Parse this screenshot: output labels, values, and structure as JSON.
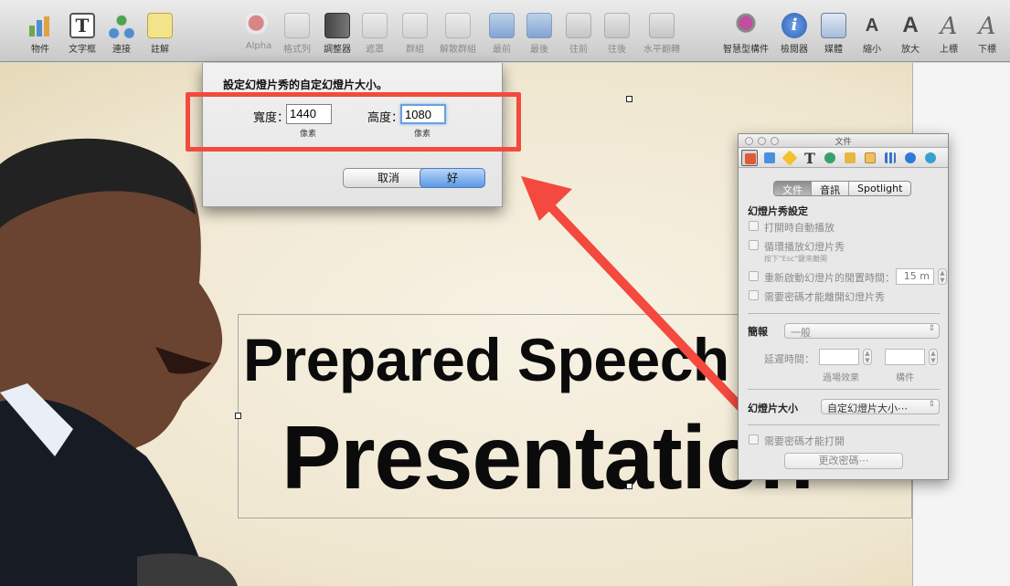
{
  "toolbar": {
    "items": [
      {
        "label": "物件",
        "icon": "chart-objects-icon"
      },
      {
        "label": "文字框",
        "icon": "text-box-icon"
      },
      {
        "label": "連接",
        "icon": "connection-icon"
      },
      {
        "label": "註解",
        "icon": "comment-icon"
      },
      {
        "label": "Alpha",
        "icon": "alpha-icon"
      },
      {
        "label": "格式列",
        "icon": "format-bar-icon"
      },
      {
        "label": "調整器",
        "icon": "adjust-image-icon"
      },
      {
        "label": "遮罩",
        "icon": "mask-icon"
      },
      {
        "label": "群組",
        "icon": "group-icon"
      },
      {
        "label": "解散群組",
        "icon": "ungroup-icon"
      },
      {
        "label": "最前",
        "icon": "front-icon"
      },
      {
        "label": "最後",
        "icon": "back-icon"
      },
      {
        "label": "往前",
        "icon": "forward-icon"
      },
      {
        "label": "往後",
        "icon": "backward-icon"
      },
      {
        "label": "水平翻轉",
        "icon": "flip-horizontal-icon"
      },
      {
        "label": "智慧型構件",
        "icon": "smart-build-icon"
      },
      {
        "label": "檢閱器",
        "icon": "inspector-icon"
      },
      {
        "label": "媒體",
        "icon": "media-icon"
      },
      {
        "label": "縮小",
        "icon": "smaller-font-icon"
      },
      {
        "label": "放大",
        "icon": "bigger-font-icon"
      },
      {
        "label": "上標",
        "icon": "superscript-icon"
      },
      {
        "label": "下標",
        "icon": "subscript-icon"
      }
    ]
  },
  "slide": {
    "line1": "Prepared Speech",
    "line2": "Presentation"
  },
  "dialog": {
    "title": "設定幻燈片秀的自定幻燈片大小。",
    "width_label": "寬度：",
    "width_value": "1440",
    "height_label": "高度：",
    "height_value": "1080",
    "unit_width": "像素",
    "unit_height": "像素",
    "cancel_label": "取消",
    "ok_label": "好"
  },
  "inspector": {
    "title": "文件",
    "tabs": [
      "文件",
      "音訊",
      "Spotlight"
    ],
    "section_title": "幻燈片秀設定",
    "opt_autoplay": "打開時自動播放",
    "opt_loop": "循環播放幻燈片秀",
    "loop_hint": "按下\"Esc\"鍵來離開",
    "opt_restart": "重新啟動幻燈片的閒置時間：",
    "restart_value": "15 m",
    "opt_password_exit": "需要密碼才能離開幻燈片秀",
    "presentation_label": "簡報",
    "presentation_value": "一般",
    "delay_label": "延遲時間：",
    "transition_label": "過場效果",
    "build_label": "構件",
    "slide_size_label": "幻燈片大小",
    "slide_size_value": "自定幻燈片大小⋯",
    "opt_password_open": "需要密碼才能打開",
    "change_password": "更改密碼⋯"
  },
  "colors": {
    "highlight": "#f4493e",
    "ok_button": "#5b99e6"
  }
}
